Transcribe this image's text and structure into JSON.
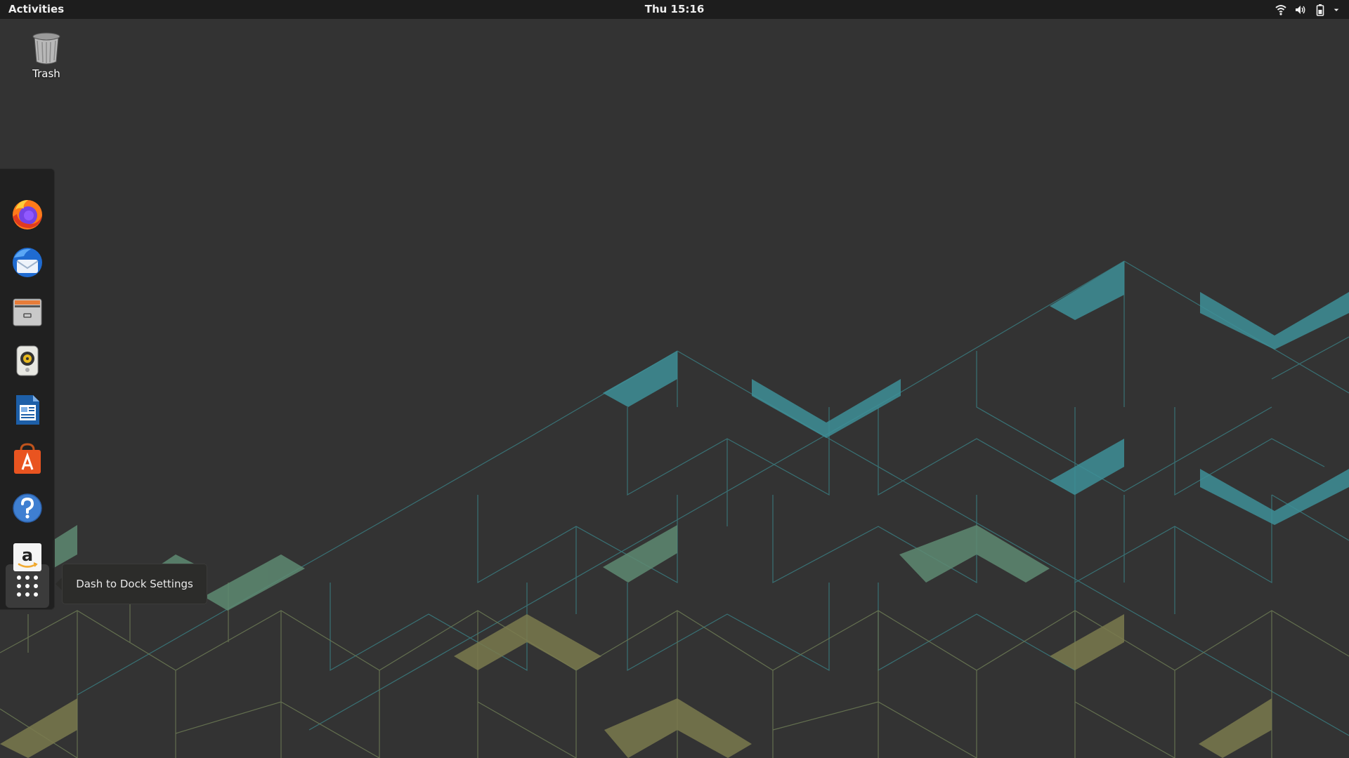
{
  "topbar": {
    "activities_label": "Activities",
    "clock": "Thu 15:16",
    "indicators": [
      "network-wifi-icon",
      "volume-icon",
      "battery-icon",
      "system-menu-arrow-icon"
    ]
  },
  "desktop": {
    "trash_label": "Trash"
  },
  "dock": {
    "items": [
      {
        "name": "Firefox Web Browser",
        "icon": "firefox-icon"
      },
      {
        "name": "Thunderbird Mail",
        "icon": "thunderbird-icon"
      },
      {
        "name": "Files",
        "icon": "files-icon"
      },
      {
        "name": "Rhythmbox",
        "icon": "rhythmbox-icon"
      },
      {
        "name": "LibreOffice Writer",
        "icon": "libreoffice-writer-icon"
      },
      {
        "name": "Ubuntu Software",
        "icon": "ubuntu-software-icon"
      },
      {
        "name": "Help",
        "icon": "help-icon"
      },
      {
        "name": "Amazon",
        "icon": "amazon-icon"
      },
      {
        "name": "Show Applications",
        "icon": "show-applications-icon"
      }
    ],
    "tooltip": "Dash to Dock Settings"
  },
  "colors": {
    "background": "#333333",
    "topbar": "#1d1d1d",
    "wallpaper_teal": "#3e8f98",
    "wallpaper_green": "#5e8a72",
    "wallpaper_olive": "#7a7a4e"
  }
}
